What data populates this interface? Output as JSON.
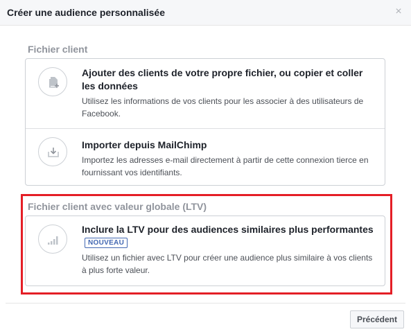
{
  "dialog": {
    "title": "Créer une audience personnalisée",
    "close_glyph": "×"
  },
  "sections": [
    {
      "title": "Fichier client",
      "options": [
        {
          "icon": "add-document-icon",
          "title": "Ajouter des clients de votre propre fichier, ou copier et coller les données",
          "description": "Utilisez les informations de vos clients pour les associer à des utilisateurs de Facebook."
        },
        {
          "icon": "import-icon",
          "title": "Importer depuis MailChimp",
          "description": "Importez les adresses e-mail directement à partir de cette connexion tierce en fournissant vos identifiants."
        }
      ]
    },
    {
      "title": "Fichier client avec valeur globale (LTV)",
      "options": [
        {
          "icon": "bar-chart-icon",
          "title": "Inclure la LTV pour des audiences similaires plus performantes",
          "badge": "NOUVEAU",
          "description": "Utilisez un fichier avec LTV pour créer une audience plus similaire à vos clients à plus forte valeur."
        }
      ]
    }
  ],
  "footer": {
    "previous_label": "Précédent"
  },
  "colors": {
    "highlight": "#e41e26",
    "badge": "#4267b2",
    "section_title": "#90949c"
  }
}
